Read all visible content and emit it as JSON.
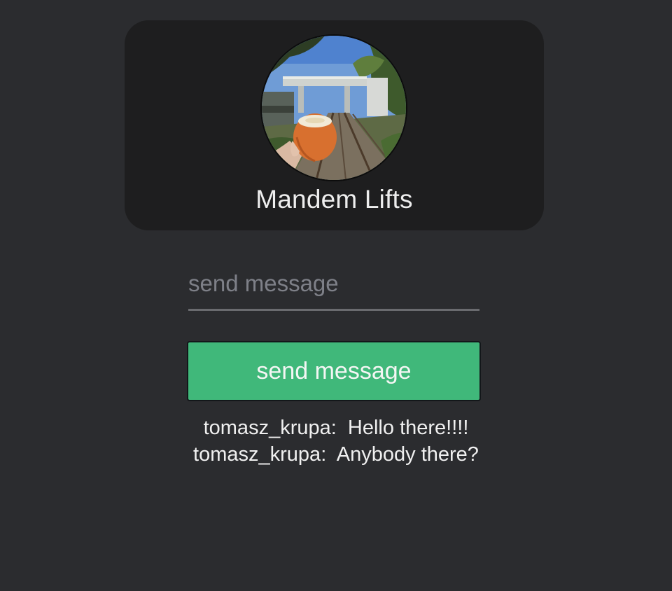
{
  "profile": {
    "name": "Mandem Lifts",
    "avatar": "photo of a hand holding a coconut on railway tracks"
  },
  "composer": {
    "placeholder": "send message",
    "value": "",
    "button_label": "send message",
    "accent_color": "#40b87a"
  },
  "messages": [
    {
      "author": "tomasz_krupa",
      "separator": ":  ",
      "text": "Hello there!!!!"
    },
    {
      "author": "tomasz_krupa",
      "separator": ":  ",
      "text": "Anybody there?"
    }
  ]
}
